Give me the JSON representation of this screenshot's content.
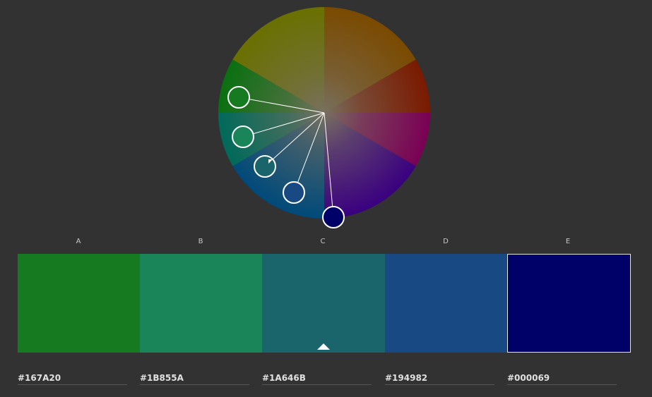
{
  "wheel": {
    "selected_index": 2,
    "handles": [
      {
        "color": "#167A20"
      },
      {
        "color": "#1B855A"
      },
      {
        "color": "#1A646B"
      },
      {
        "color": "#194982"
      },
      {
        "color": "#000069"
      }
    ]
  },
  "swatches": [
    {
      "label": "A",
      "hex": "#167A20",
      "color": "#167A20"
    },
    {
      "label": "B",
      "hex": "#1B855A",
      "color": "#1B855A"
    },
    {
      "label": "C",
      "hex": "#1A646B",
      "color": "#1A646B"
    },
    {
      "label": "D",
      "hex": "#194982",
      "color": "#194982"
    },
    {
      "label": "E",
      "hex": "#000069",
      "color": "#000069"
    }
  ],
  "selected_swatch": "C"
}
